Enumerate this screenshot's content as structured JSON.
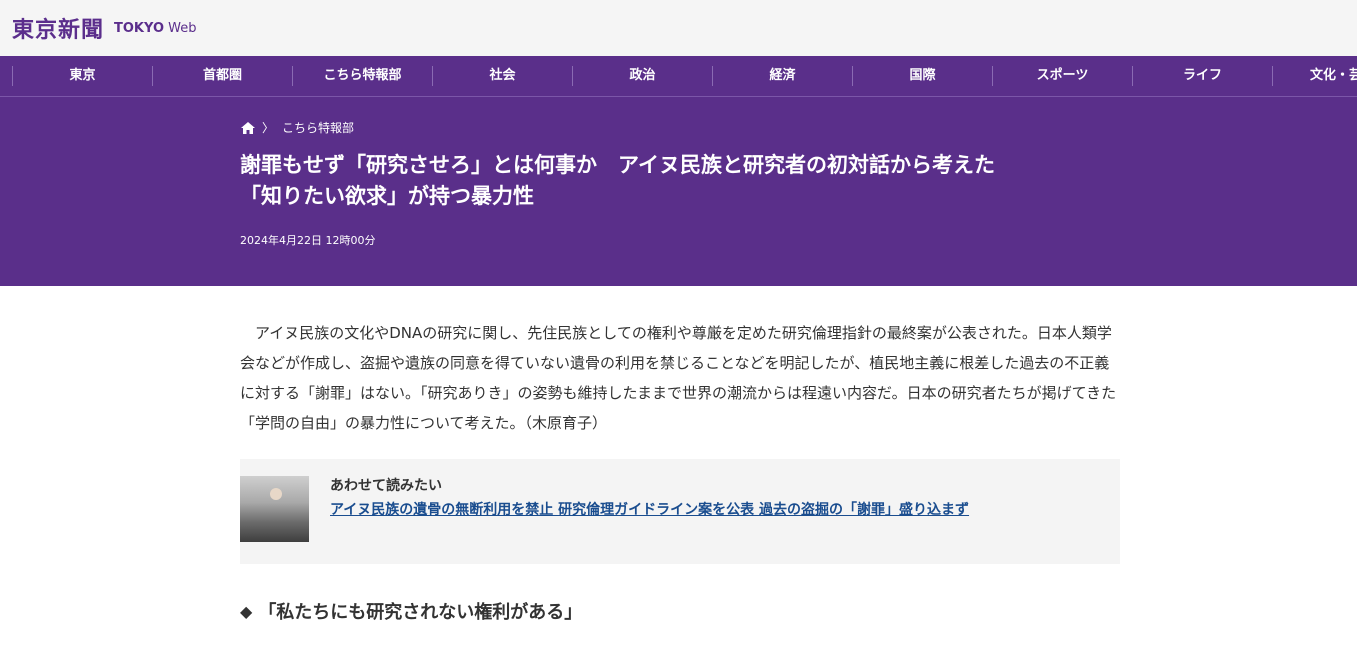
{
  "header": {
    "logo_text": "東京新聞",
    "logo_sub_bold": "TOKYO",
    "logo_sub_light": "Web"
  },
  "nav": {
    "items": [
      "東京",
      "首都圏",
      "こちら特報部",
      "社会",
      "政治",
      "経済",
      "国際",
      "スポーツ",
      "ライフ",
      "文化・芸能"
    ]
  },
  "article": {
    "breadcrumb": "こちら特報部",
    "title_line1": "謝罪もせず「研究させろ」とは何事か　アイヌ民族と研究者の初対話から考えた",
    "title_line2": "「知りたい欲求」が持つ暴力性",
    "date": "2024年4月22日 12時00分",
    "lead": "アイヌ民族の文化やDNAの研究に関し、先住民族としての権利や尊厳を定めた研究倫理指針の最終案が公表された。日本人類学会などが作成し、盗掘や遺族の同意を得ていない遺骨の利用を禁じることなどを明記したが、植民地主義に根差した過去の不正義に対する「謝罪」はない。「研究ありき」の姿勢も維持したままで世界の潮流からは程遠い内容だ。日本の研究者たちが掲げてきた「学問の自由」の暴力性について考えた。（木原育子）",
    "related_label": "あわせて読みたい",
    "related_link": "アイヌ民族の遺骨の無断利用を禁止 研究倫理ガイドライン案を公表 過去の盗掘の「謝罪」盛り込まず",
    "section_heading": "「私たちにも研究されない権利がある」",
    "section_marker": "◆"
  },
  "colors": {
    "brand_purple": "#5a2f8a",
    "link_blue": "#1a4d8f"
  }
}
